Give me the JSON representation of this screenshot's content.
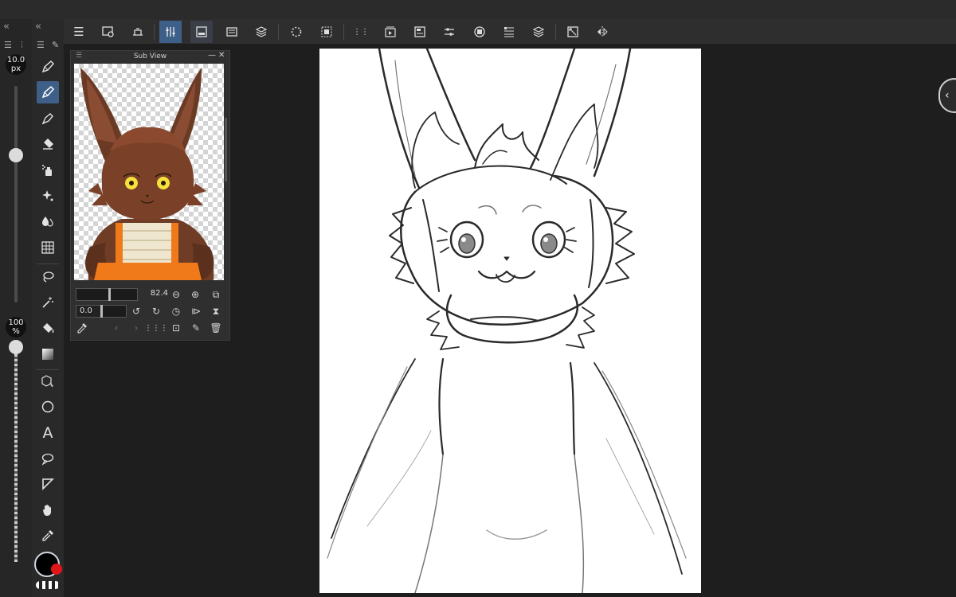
{
  "brush_size": {
    "value": "10.0",
    "unit": "px",
    "level": 0.68
  },
  "opacity": {
    "value": "100",
    "unit": "%",
    "level": 1.0
  },
  "sub_view": {
    "title": "Sub View",
    "zoom_value": "82.4",
    "rotation_value": "0.0"
  },
  "colors": {
    "accent": "#3e5f87",
    "main_color": "#000000",
    "sub_color": "#e0161b",
    "canvas": "#ffffff"
  },
  "icons": {
    "command_bar": [
      "menu-icon",
      "find-icon",
      "gallery-icon",
      "tool-property-icon",
      "layer-property-icon",
      "sub-tool-icon",
      "layers-icon",
      "loading-icon",
      "selection-icon",
      "grid-icon",
      "animation-icon",
      "navigator-icon",
      "adjust-icon",
      "color-circle-icon",
      "layer-search-icon",
      "layer-stack-icon",
      "fit-icon",
      "flip-icon"
    ],
    "tools": [
      "pen-icon",
      "pen-selected-icon",
      "marker-icon",
      "eraser-icon",
      "airbrush-icon",
      "decoration-icon",
      "blend-icon",
      "mesh-icon",
      "lasso-icon",
      "magic-wand-icon",
      "fill-icon",
      "gradient-icon",
      "operation-icon",
      "figure-icon",
      "text-icon",
      "balloon-icon",
      "ruler-icon",
      "hand-icon",
      "eyedropper-icon"
    ]
  }
}
